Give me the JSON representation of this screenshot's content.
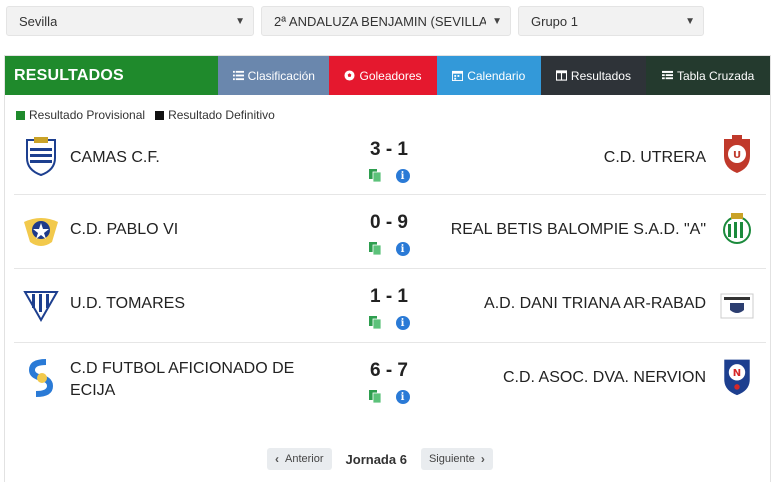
{
  "filters": {
    "region": "Sevilla",
    "competition": "2ª ANDALUZA BENJAMIN (SEVILLA)",
    "group": "Grupo 1"
  },
  "nav": {
    "title": "RESULTADOS",
    "tabs": [
      "Clasificación",
      "Goleadores",
      "Calendario",
      "Resultados",
      "Tabla Cruzada"
    ]
  },
  "legend": {
    "provisional": "Resultado Provisional",
    "definitivo": "Resultado Definitivo"
  },
  "matches": [
    {
      "home": "CAMAS C.F.",
      "score": "3 - 1",
      "away": "C.D. UTRERA"
    },
    {
      "home": "C.D. PABLO VI",
      "score": "0 - 9",
      "away": "REAL BETIS BALOMPIE S.A.D. \"A\""
    },
    {
      "home": "U.D. TOMARES",
      "score": "1 - 1",
      "away": "A.D. DANI TRIANA AR-RABAD"
    },
    {
      "home": "C.D FUTBOL AFICIONADO DE ECIJA",
      "score": "6 - 7",
      "away": "C.D. ASOC. DVA. NERVION"
    }
  ],
  "pager": {
    "prev": "Anterior",
    "jornada": "Jornada 6",
    "next": "Siguiente"
  },
  "colors": {
    "provisional": "#1f8a2c",
    "definitivo": "#111111"
  }
}
